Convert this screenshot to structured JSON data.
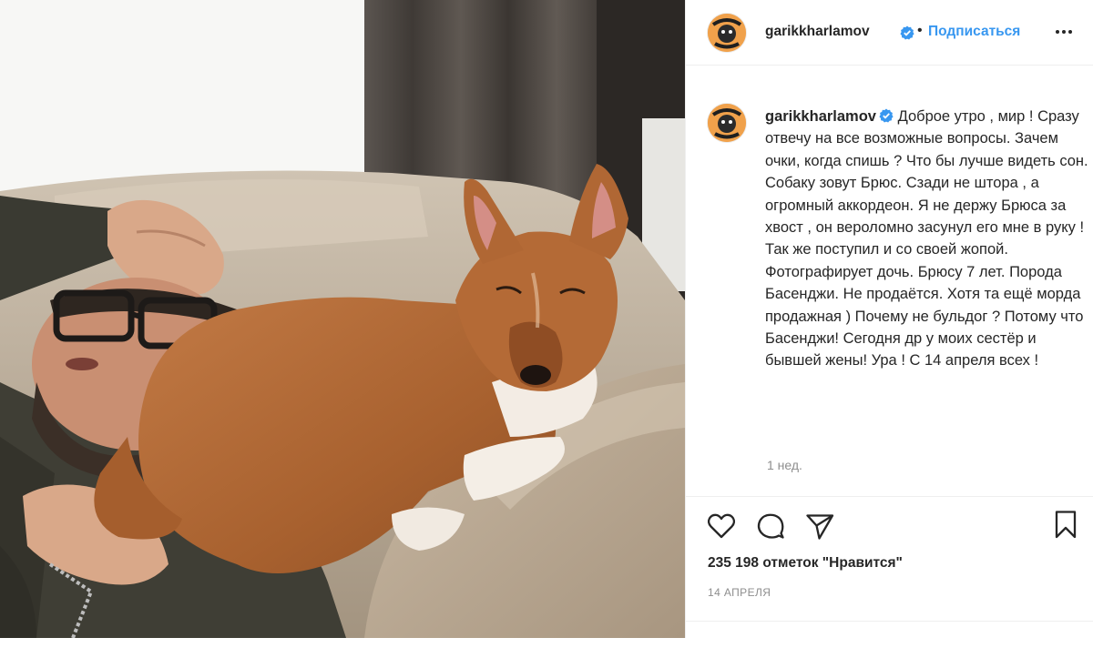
{
  "post": {
    "username": "garikkharlamov",
    "verified": true,
    "separator": "•",
    "follow_label": "Подписаться",
    "more_icon": "more-options-icon",
    "avatar_text": "BULL DOG",
    "caption": "Доброе утро , мир ! Сразу отвечу на все возможные вопросы. Зачем очки, когда спишь ? Что бы лучше видеть сон. Собаку зовут Брюс. Сзади не штора , а огромный аккордеон. Я не держу Брюса за хвост , он вероломно засунул его мне в руку ! Так же поступил и со своей жопой. Фотографирует дочь. Брюсу 7 лет. Порода Басенджи. Не продаётся. Хотя та ещё морда продажная ) Почему не бульдог ? Потому что Басенджи! Сегодня др у моих сестёр и бывшей жены! Ура ! С 14 апреля всех !",
    "time_ago": "1 нед.",
    "likes": "235 198 отметок \"Нравится\"",
    "date": "14 АПРЕЛЯ",
    "comment_placeholder": ""
  },
  "icons": {
    "like": "heart-icon",
    "comment": "comment-icon",
    "share": "paper-plane-icon",
    "save": "bookmark-icon",
    "verified": "verified-badge-icon"
  },
  "colors": {
    "link": "#3897f0",
    "verified": "#3897f0",
    "text": "#262626",
    "muted": "#8e8e8e",
    "border": "#efefef"
  }
}
